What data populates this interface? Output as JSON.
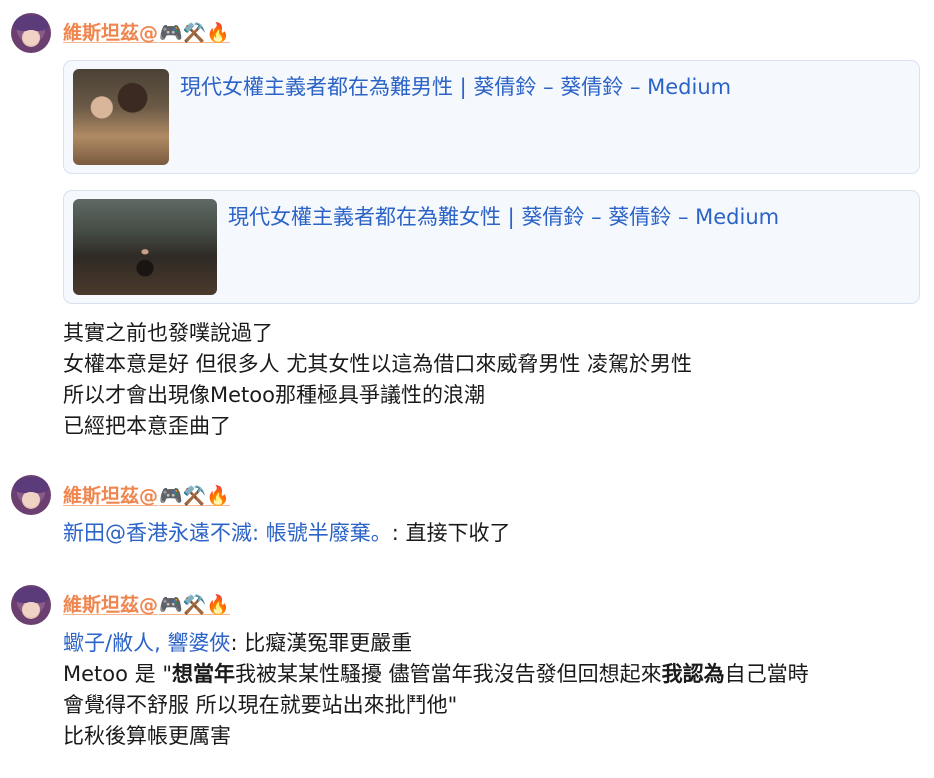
{
  "posts": [
    {
      "author": "維斯坦茲@",
      "emojis": "🎮⚒️🔥",
      "cards": [
        {
          "title": "現代女權主義者都在為難男性 | 葵倩鈴 – 葵倩鈴 – Medium"
        },
        {
          "title": "現代女權主義者都在為難女性 | 葵倩鈴 – 葵倩鈴 – Medium"
        }
      ],
      "lines": [
        "其實之前也發噗說過了",
        "女權本意是好 但很多人 尤其女性以這為借口來威脅男性 凌駕於男性",
        "所以才會出現像Metoo那種極具爭議性的浪潮",
        "已經把本意歪曲了"
      ]
    },
    {
      "author": "維斯坦茲@",
      "emojis": "🎮⚒️🔥",
      "quote_user": "新田@香港永遠不滅",
      "quote_sep": ": ",
      "quote_text": "帳號半廢棄。",
      "reply": ": 直接下收了"
    },
    {
      "author": "維斯坦茲@",
      "emojis": "🎮⚒️🔥",
      "quote_user": "蠍子/敝人, 響婆俠",
      "reply": ": 比癡漢冤罪更嚴重",
      "line2": {
        "a": "Metoo 是 \"",
        "b1": "想當年",
        "c": "我被某某性騷擾 儘管當年我沒告發但回想起來",
        "b2": "我認為",
        "d": "自己當時"
      },
      "line3": "會覺得不舒服 所以現在就要站出來批鬥他\"",
      "line4": "比秋後算帳更厲害"
    }
  ]
}
